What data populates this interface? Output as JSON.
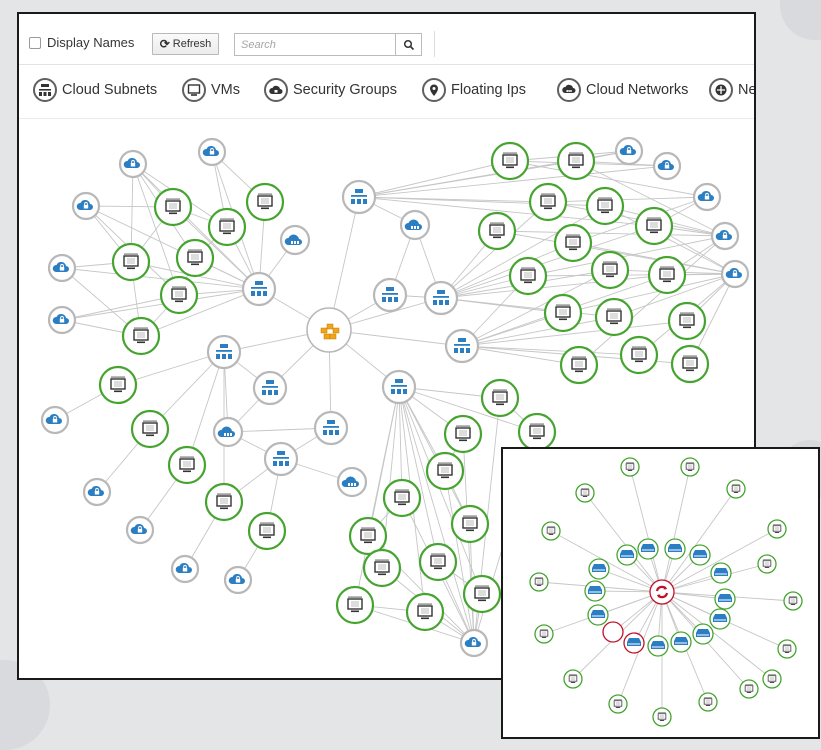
{
  "toolbar": {
    "display_names_label": "Display Names",
    "refresh_label": "Refresh",
    "search_placeholder": "Search"
  },
  "legend": {
    "items": [
      {
        "label": "Cloud Subnets",
        "icon": "subnet-icon"
      },
      {
        "label": "VMs",
        "icon": "vm-icon"
      },
      {
        "label": "Security Groups",
        "icon": "security-group-icon"
      },
      {
        "label": "Floating Ips",
        "icon": "floating-ip-icon"
      },
      {
        "label": "Cloud Networks",
        "icon": "cloud-network-icon"
      },
      {
        "label": "Ne",
        "icon": "network-router-icon"
      }
    ]
  },
  "colors": {
    "vm_ring": "#45a42f",
    "neutral_ring": "#b8b8b8",
    "icon_blue": "#2b7ec1",
    "provider_orange": "#f1a516",
    "alert_red": "#c0112a",
    "edge": "#c6c6c6"
  }
}
